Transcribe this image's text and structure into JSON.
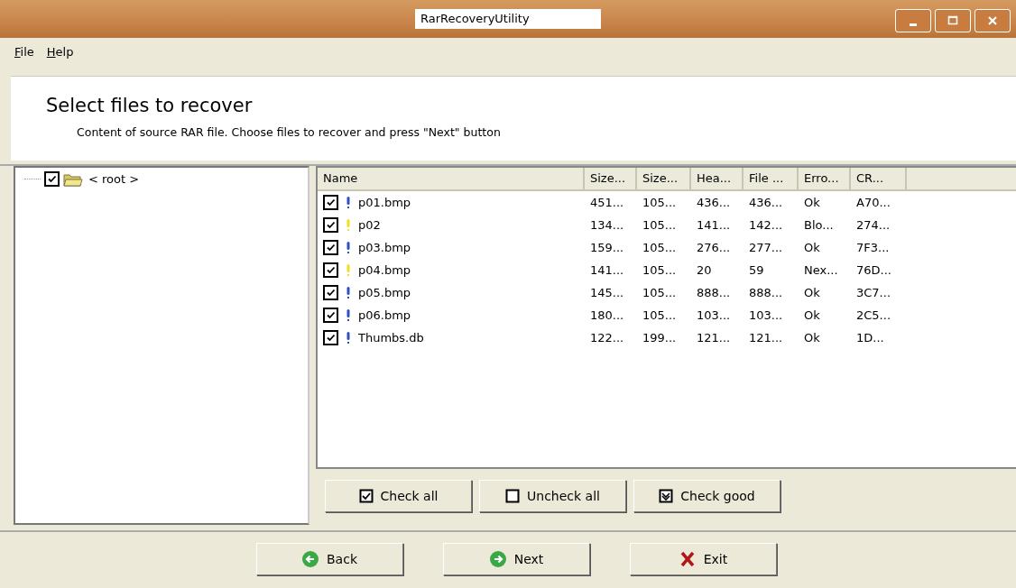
{
  "window": {
    "title": "RarRecoveryUtility"
  },
  "menu": [
    "File",
    "Help"
  ],
  "header": {
    "title": "Select files to recover",
    "subtitle": "Content of source RAR file. Choose files to recover and press \"Next\" button"
  },
  "tree": [
    {
      "label": "< root >",
      "checked": true
    }
  ],
  "table": {
    "columns": [
      "Name",
      "Size...",
      "Size...",
      "Hea...",
      "File ...",
      "Erro...",
      "CR..."
    ],
    "rows": [
      {
        "checked": true,
        "color": "#3050c0",
        "cells": [
          "p01.bmp",
          "451...",
          "105...",
          "436...",
          "436...",
          "Ok",
          "A70..."
        ]
      },
      {
        "checked": true,
        "color": "#f0e020",
        "cells": [
          "p02",
          "134...",
          "105...",
          "141...",
          "142...",
          "Blo...",
          "274..."
        ]
      },
      {
        "checked": true,
        "color": "#3050c0",
        "cells": [
          "p03.bmp",
          "159...",
          "105...",
          "276...",
          "277...",
          "Ok",
          "7F3..."
        ]
      },
      {
        "checked": true,
        "color": "#f0e020",
        "cells": [
          "p04.bmp",
          "141...",
          "105...",
          "20",
          "59",
          "Nex...",
          "76D..."
        ]
      },
      {
        "checked": true,
        "color": "#3050c0",
        "cells": [
          "p05.bmp",
          "145...",
          "105...",
          "888...",
          "888...",
          "Ok",
          "3C7..."
        ]
      },
      {
        "checked": true,
        "color": "#3050c0",
        "cells": [
          "p06.bmp",
          "180...",
          "105...",
          "103...",
          "103...",
          "Ok",
          "2C5..."
        ]
      },
      {
        "checked": true,
        "color": "#3050c0",
        "cells": [
          "Thumbs.db",
          "122...",
          "199...",
          "121...",
          "121...",
          "Ok",
          "1D..."
        ]
      }
    ]
  },
  "check_buttons": [
    {
      "kind": "check",
      "label": "Check all"
    },
    {
      "kind": "uncheck",
      "label": "Uncheck all"
    },
    {
      "kind": "good",
      "label": "Check good"
    }
  ],
  "nav_buttons": [
    {
      "kind": "back",
      "label": "Back"
    },
    {
      "kind": "next",
      "label": "Next"
    },
    {
      "kind": "exit",
      "label": "Exit"
    }
  ]
}
